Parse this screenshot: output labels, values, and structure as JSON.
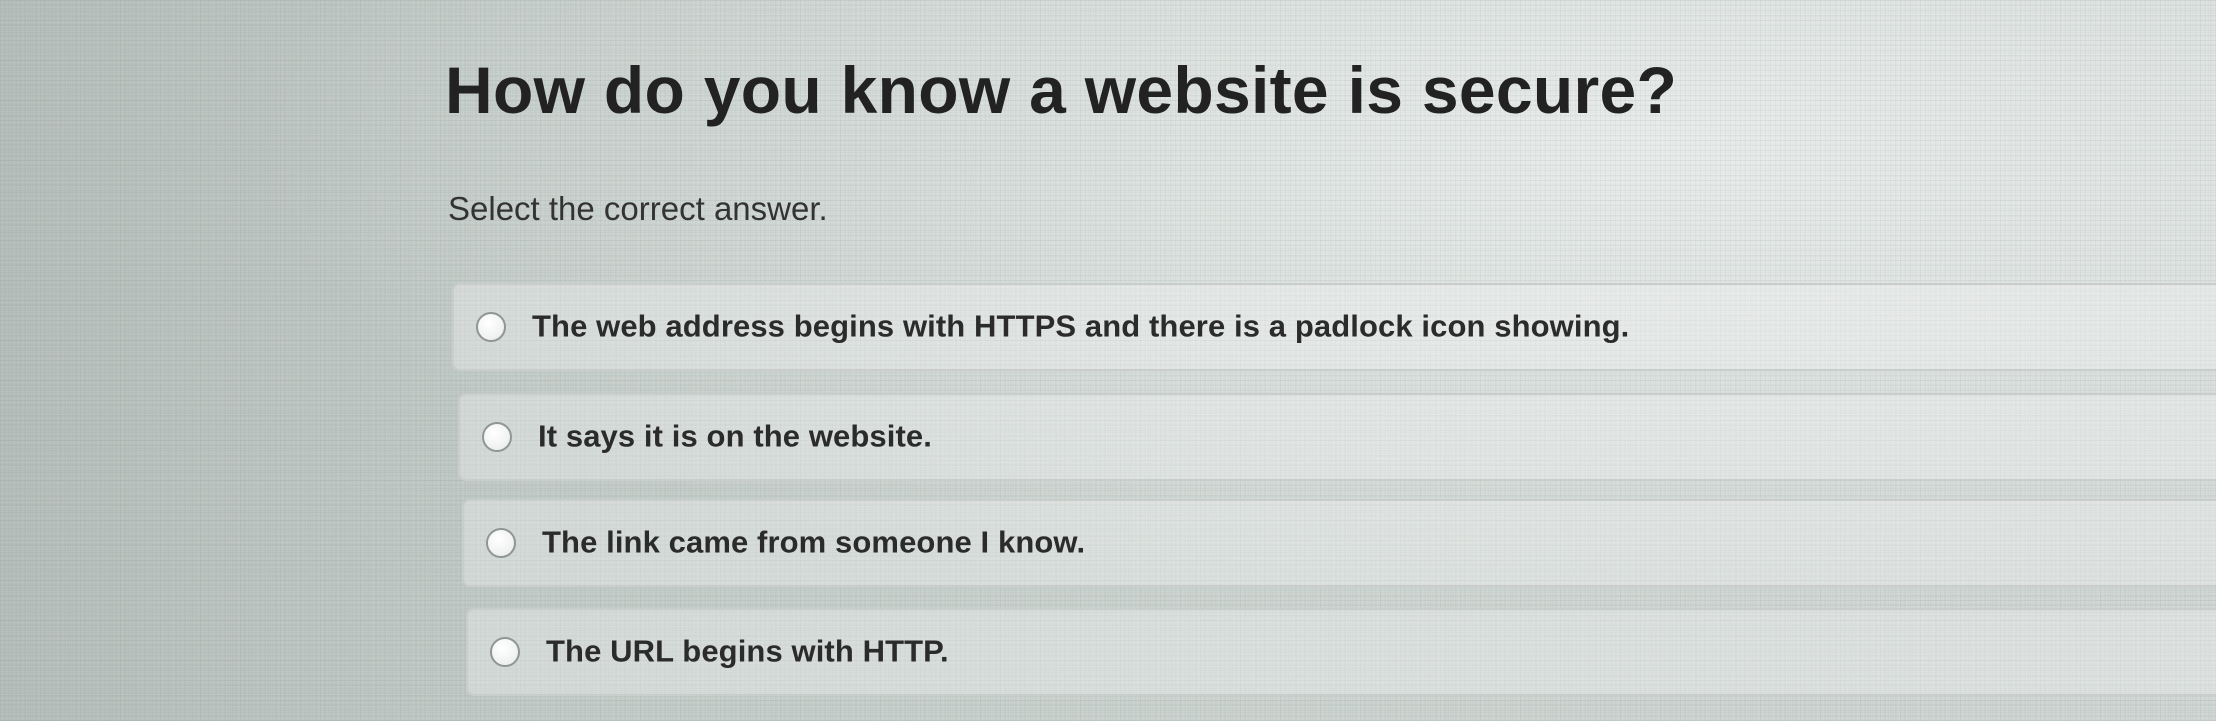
{
  "question": {
    "title": "How do you know a website is secure?",
    "instruction": "Select the correct answer."
  },
  "options": [
    {
      "label": "The web address begins with HTTPS and there is a padlock icon showing.",
      "selected": false
    },
    {
      "label": "It says it is on the website.",
      "selected": false
    },
    {
      "label": "The link came from someone I know.",
      "selected": false
    },
    {
      "label": "The URL begins with HTTP.",
      "selected": false
    }
  ],
  "icons": {
    "radio": "radio-button-icon"
  },
  "colors": {
    "text": "#222222",
    "border": "#c9cecc",
    "radio_border": "#8f9693"
  }
}
